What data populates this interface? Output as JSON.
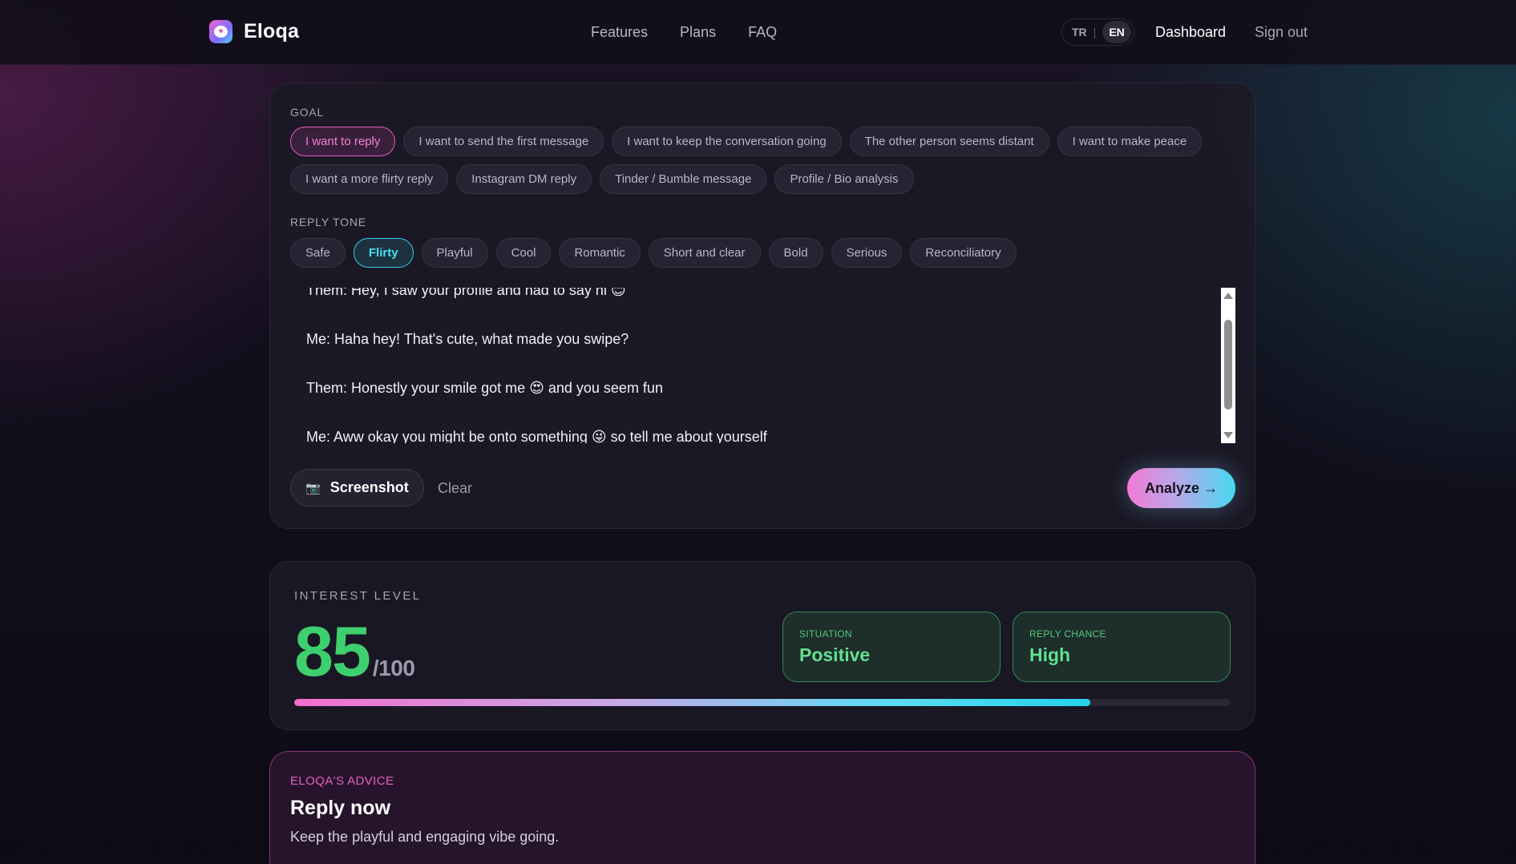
{
  "nav": {
    "logo_text": "Eloqa",
    "links": [
      "Features",
      "Plans",
      "FAQ"
    ],
    "lang_tr": "TR",
    "lang_sep": "|",
    "lang_en": "EN",
    "dashboard": "Dashboard",
    "sign_out": "Sign out"
  },
  "goal": {
    "label": "GOAL",
    "row1": [
      "I want to reply",
      "I want to send the first message",
      "I want to keep the conversation going",
      "The other person seems distant",
      "I want to make peace"
    ],
    "row2": [
      "I want a more flirty reply",
      "Instagram DM reply",
      "Tinder / Bumble message",
      "Profile / Bio analysis"
    ],
    "selected": "I want to reply"
  },
  "tone": {
    "label": "REPLY TONE",
    "options": [
      "Safe",
      "Flirty",
      "Playful",
      "Cool",
      "Romantic",
      "Short and clear",
      "Bold",
      "Serious",
      "Reconciliatory"
    ],
    "selected": "Flirty"
  },
  "conversation": {
    "lines": [
      "Them: Hey, I saw your profile and had to say hi 😊",
      "Me: Haha hey! That's cute, what made you swipe?",
      "Them: Honestly your smile got me 😍 and you seem fun",
      "Me: Aww okay you might be onto something 😜 so tell me about yourself"
    ]
  },
  "actions": {
    "camera_icon": "📷",
    "screenshot": "Screenshot",
    "clear": "Clear",
    "analyze": "Analyze →"
  },
  "interest": {
    "label": "INTEREST LEVEL",
    "score": "85",
    "out_of": "/100",
    "progress_fraction": 0.85,
    "situation_label": "SITUATION",
    "situation_value": "Positive",
    "chance_label": "REPLY CHANCE",
    "chance_value": "High"
  },
  "advice": {
    "label": "ELOQA'S ADVICE",
    "title": "Reply now",
    "body": "Keep the playful and engaging vibe going."
  },
  "colors": {
    "accent_pink": "#e858c0",
    "accent_cyan": "#2fd0e6",
    "positive_green": "#3ed06e"
  }
}
